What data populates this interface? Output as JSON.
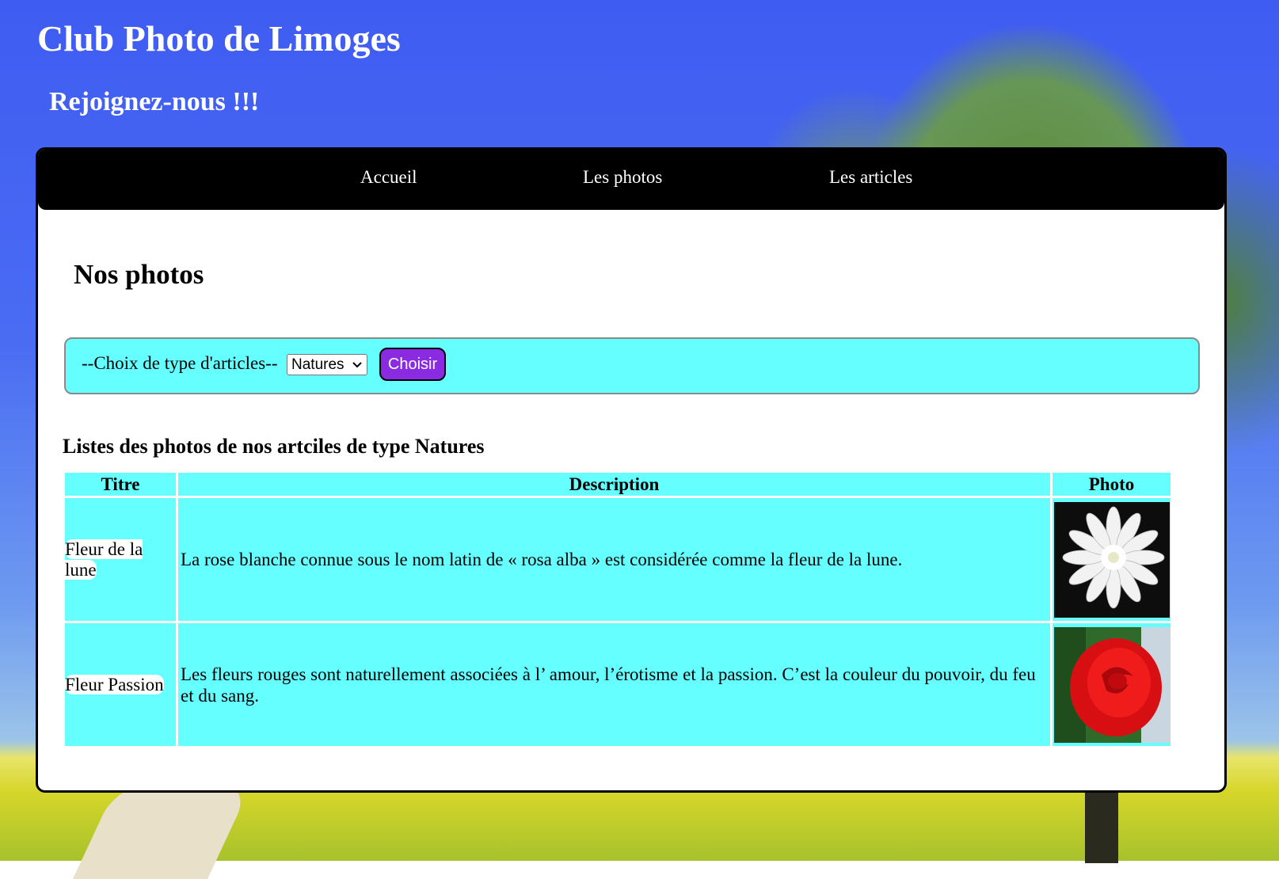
{
  "header": {
    "title": "Club Photo de Limoges",
    "subtitle": "Rejoignez-nous !!!"
  },
  "nav": {
    "items": [
      {
        "label": "Accueil"
      },
      {
        "label": "Les photos"
      },
      {
        "label": "Les articles"
      }
    ]
  },
  "main": {
    "page_title": "Nos photos",
    "filter": {
      "label": "--Choix de type d'articles--",
      "selected": "Natures",
      "button_label": "Choisir"
    },
    "list_heading": "Listes des photos de nos artciles de type Natures",
    "table": {
      "columns": [
        "Titre",
        "Description",
        "Photo"
      ],
      "rows": [
        {
          "title": "Fleur de la lune",
          "description": "La rose blanche connue sous le nom latin de « rosa alba » est considérée comme la fleur de la lune.",
          "photo": "white-flower-photo"
        },
        {
          "title": "Fleur Passion",
          "description": "Les fleurs rouges sont naturellement associées à l’ amour, l’érotisme et la passion. C’est la couleur du pouvoir, du feu et du sang.",
          "photo": "red-rose-photo"
        }
      ]
    }
  },
  "colors": {
    "accent_cyan": "#66ffff",
    "button_purple": "#8a2be2",
    "navbar": "#000000",
    "sky_blue": "#3f5cf2"
  }
}
